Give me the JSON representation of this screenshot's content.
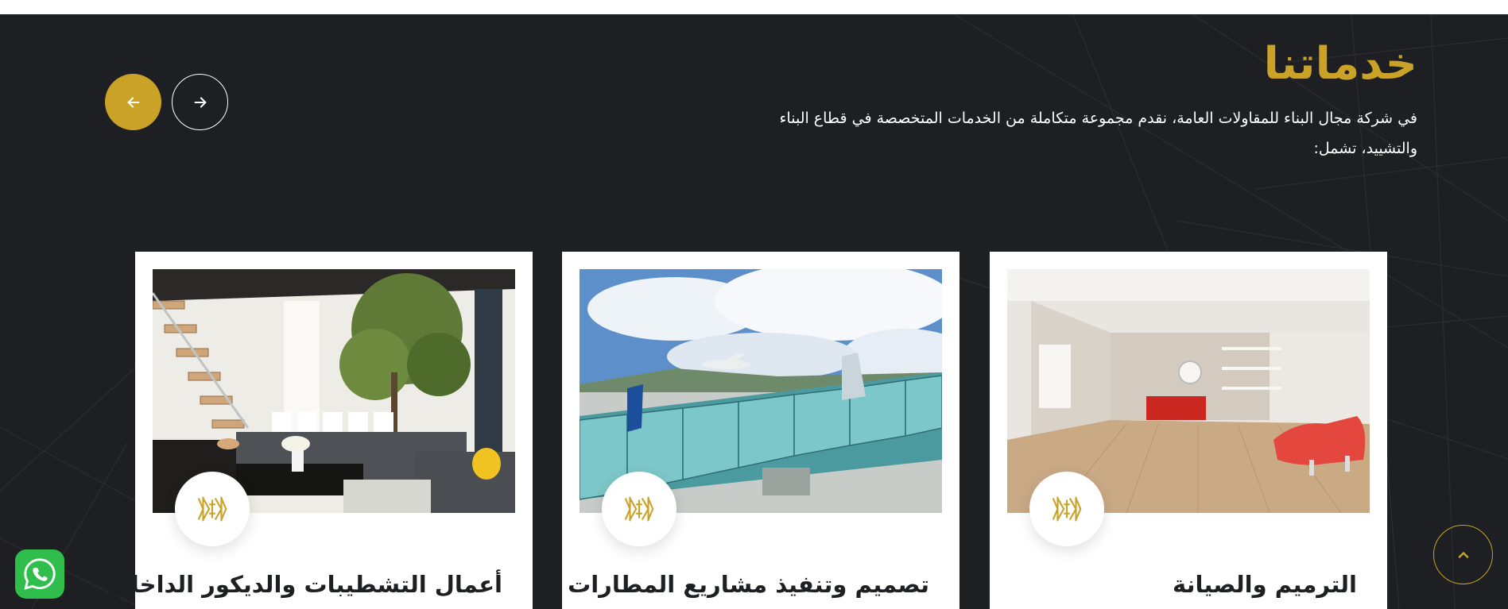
{
  "colors": {
    "accent": "#c9a227",
    "section_bg": "#1e1f22",
    "whatsapp": "#2fbe4c"
  },
  "services": {
    "title": "خدماتنا",
    "description": "في شركة مجال البناء للمقاولات العامة، نقدم مجموعة متكاملة من الخدمات المتخصصة في قطاع البناء والتشييد، تشمل:"
  },
  "carousel": {
    "prev_icon": "arrow-left-icon",
    "next_icon": "arrow-right-icon"
  },
  "cards": [
    {
      "title": "الترميم والصيانة",
      "image": "empty-room-interior",
      "badge_icon": "building-logo-icon"
    },
    {
      "title": "تصميم وتنفيذ مشاريع المطارات",
      "image": "airport-jet-bridge",
      "badge_icon": "building-logo-icon"
    },
    {
      "title": "أعمال التشطيبات والديكور الداخلي",
      "image": "modern-living-room",
      "badge_icon": "building-logo-icon"
    }
  ],
  "widgets": {
    "scroll_top_icon": "chevron-up-icon",
    "whatsapp_icon": "whatsapp-icon"
  }
}
